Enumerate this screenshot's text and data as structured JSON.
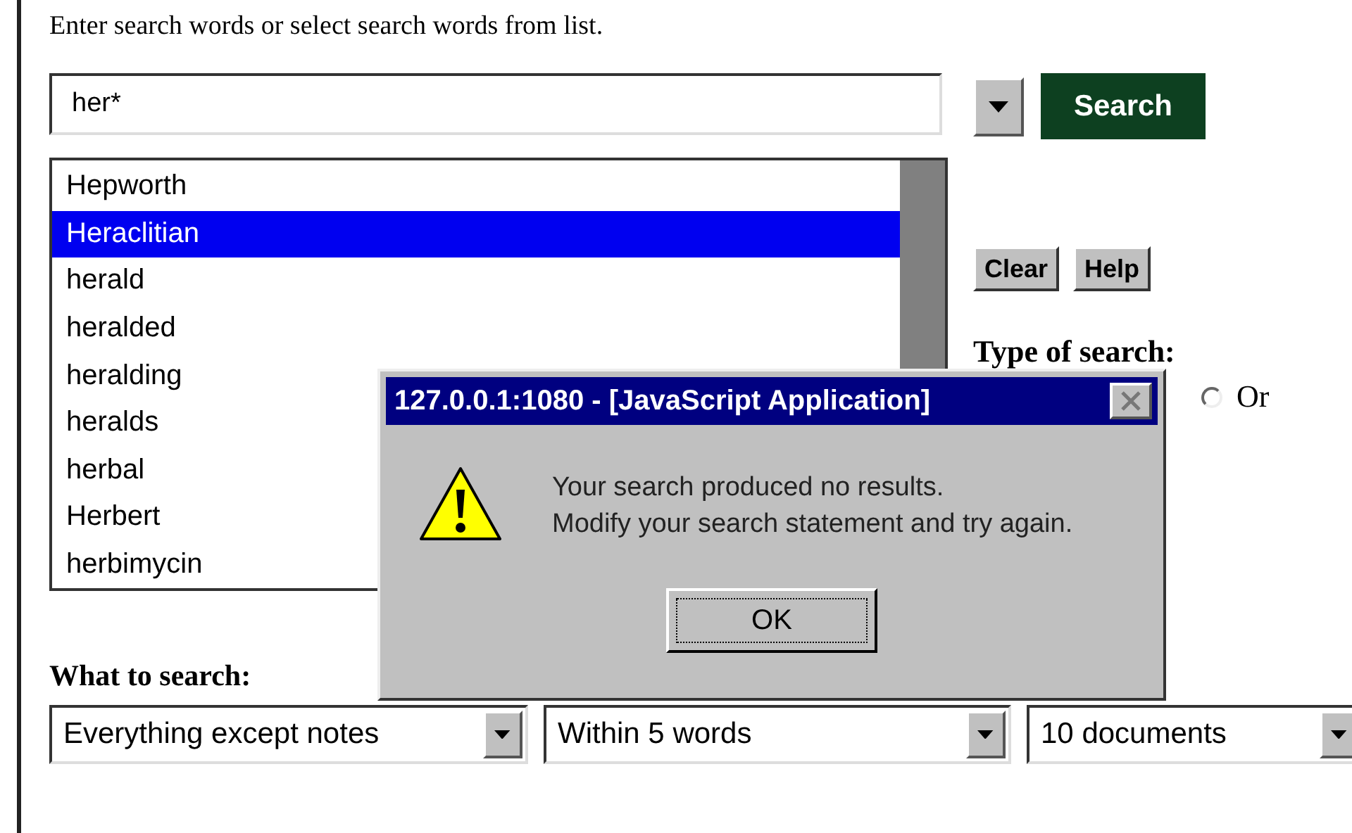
{
  "instruction": "Enter search words or select search words from list.",
  "search_field": {
    "value": "her*"
  },
  "search_button": "Search",
  "word_list": [
    {
      "label": "Hepworth",
      "selected": false
    },
    {
      "label": "Heraclitian",
      "selected": true
    },
    {
      "label": "herald",
      "selected": false
    },
    {
      "label": "heralded",
      "selected": false
    },
    {
      "label": "heralding",
      "selected": false
    },
    {
      "label": "heralds",
      "selected": false
    },
    {
      "label": "herbal",
      "selected": false
    },
    {
      "label": "Herbert",
      "selected": false
    },
    {
      "label": "herbimycin",
      "selected": false
    }
  ],
  "buttons": [
    "Clear",
    "Help"
  ],
  "type_of_search": {
    "label": "Type of search:",
    "options": [
      {
        "label": "Or",
        "selected": false
      }
    ]
  },
  "what_to_search": {
    "label": "What to search:",
    "selects": [
      {
        "value": "Everything except notes"
      },
      {
        "value": "Within 5 words"
      },
      {
        "value": "10 documents"
      }
    ]
  },
  "dialog": {
    "title": "127.0.0.1:1080 - [JavaScript Application]",
    "message": [
      "Your search produced no results.",
      "Modify your search statement and try again."
    ],
    "button": "OK"
  }
}
